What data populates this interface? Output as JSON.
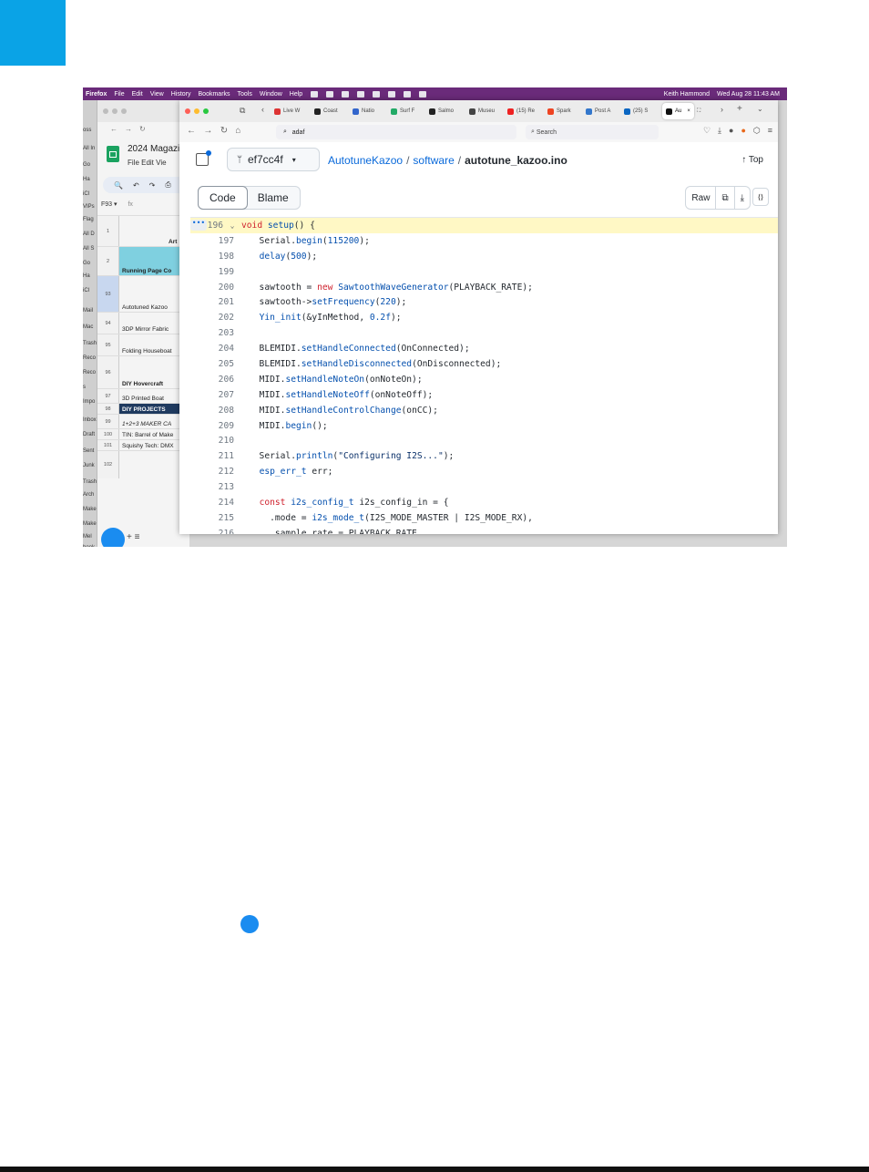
{
  "menubar": {
    "app": "Firefox",
    "items": [
      "File",
      "Edit",
      "View",
      "History",
      "Bookmarks",
      "Tools",
      "Window",
      "Help"
    ],
    "user": "Keith Hammond",
    "datetime": "Wed Aug 28  11:43 AM"
  },
  "mail_sidebar": [
    "oss",
    "All In",
    "Go",
    "Ha",
    "iCl",
    "VIPs",
    "Flag",
    "All D",
    "All S",
    "Go",
    "Ha",
    "iCl",
    "Mail",
    "Mac",
    "Trash",
    "Reco",
    "Reco",
    "s",
    "Impo",
    "Inbox",
    "Draft",
    "Sent",
    "Junk",
    "Trash",
    "Arch",
    "Make",
    "Make",
    "Mel",
    "book"
  ],
  "sheets": {
    "title": "2024 Magazi",
    "menus": "File  Edit  Vie",
    "tools": [
      "🔍",
      "↶",
      "↷",
      "⎙"
    ],
    "cellref": "F93",
    "cellfn": "fx",
    "rows": [
      {
        "n": "1",
        "t": "Art"
      },
      {
        "n": "2",
        "t": "Running Page Co"
      },
      {
        "n": "93",
        "t": "Autotuned Kazoo"
      },
      {
        "n": "94",
        "t": "3DP Mirror Fabric"
      },
      {
        "n": "95",
        "t": "Folding Houseboat"
      },
      {
        "n": "96",
        "t": "DIY Hovercraft"
      },
      {
        "n": "97",
        "t": "3D Printed Boat"
      },
      {
        "n": "98",
        "t": "DIY PROJECTS"
      },
      {
        "n": "99",
        "t": "1+2+3 MAKER CA"
      },
      {
        "n": "100",
        "t": "TIN: Barrel of Make"
      },
      {
        "n": "101",
        "t": "Squishy Tech: DMX"
      },
      {
        "n": "102",
        "t": ""
      }
    ],
    "bottom": "+   ≡"
  },
  "browser": {
    "tabs": [
      {
        "label": "Live W",
        "color": "#d33"
      },
      {
        "label": "Coast",
        "color": "#222"
      },
      {
        "label": "Natio",
        "color": "#36c"
      },
      {
        "label": "Surf F",
        "color": "#2a6"
      },
      {
        "label": "Salmo",
        "color": "#222"
      },
      {
        "label": "Museu",
        "color": "#444"
      },
      {
        "label": "(15) Re",
        "color": "#e22"
      },
      {
        "label": "Spark",
        "color": "#e42"
      },
      {
        "label": "Post A",
        "color": "#37c"
      },
      {
        "label": "(25) S",
        "color": "#0a66c2"
      },
      {
        "label": "Au",
        "color": "#111"
      }
    ],
    "url": "adaf",
    "search_placeholder": "Search"
  },
  "github": {
    "branch": "ef7cc4f",
    "crumbs": [
      "AutotuneKazoo",
      "software",
      "autotune_kazoo.ino"
    ],
    "top": "Top",
    "code_tab": "Code",
    "blame_tab": "Blame",
    "raw": "Raw"
  },
  "code_lines": [
    {
      "n": "196",
      "html": "<span class=\"kw\">void</span> <span class=\"fn\">setup</span>() {"
    },
    {
      "n": "197",
      "html": "  Serial.<span class=\"fn\">begin</span>(<span class=\"num\">115200</span>);"
    },
    {
      "n": "198",
      "html": "  <span class=\"fn\">delay</span>(<span class=\"num\">500</span>);"
    },
    {
      "n": "199",
      "html": ""
    },
    {
      "n": "200",
      "html": "  sawtooth = <span class=\"kw\">new</span> <span class=\"fn\">SawtoothWaveGenerator</span>(PLAYBACK_RATE);"
    },
    {
      "n": "201",
      "html": "  sawtooth-><span class=\"fn\">setFrequency</span>(<span class=\"num\">220</span>);"
    },
    {
      "n": "202",
      "html": "  <span class=\"fn\">Yin_init</span>(&amp;yInMethod, <span class=\"num\">0.2f</span>);"
    },
    {
      "n": "203",
      "html": ""
    },
    {
      "n": "204",
      "html": "  BLEMIDI.<span class=\"fn\">setHandleConnected</span>(OnConnected);"
    },
    {
      "n": "205",
      "html": "  BLEMIDI.<span class=\"fn\">setHandleDisconnected</span>(OnDisconnected);"
    },
    {
      "n": "206",
      "html": "  MIDI.<span class=\"fn\">setHandleNoteOn</span>(onNoteOn);"
    },
    {
      "n": "207",
      "html": "  MIDI.<span class=\"fn\">setHandleNoteOff</span>(onNoteOff);"
    },
    {
      "n": "208",
      "html": "  MIDI.<span class=\"fn\">setHandleControlChange</span>(onCC);"
    },
    {
      "n": "209",
      "html": "  MIDI.<span class=\"fn\">begin</span>();"
    },
    {
      "n": "210",
      "html": ""
    },
    {
      "n": "211",
      "html": "  Serial.<span class=\"fn\">println</span>(<span class=\"str\">\"Configuring I2S...\"</span>);"
    },
    {
      "n": "212",
      "html": "  <span class=\"fn\">esp_err_t</span> err;"
    },
    {
      "n": "213",
      "html": ""
    },
    {
      "n": "214",
      "html": "  <span class=\"kw\">const</span> <span class=\"fn\">i2s_config_t</span> i2s_config_in = {"
    },
    {
      "n": "215",
      "html": "    .mode = <span class=\"fn\">i2s_mode_t</span>(I2S_MODE_MASTER | I2S_MODE_RX),"
    },
    {
      "n": "216",
      "html": "    .sample_rate = PLAYBACK_RATE,"
    }
  ]
}
